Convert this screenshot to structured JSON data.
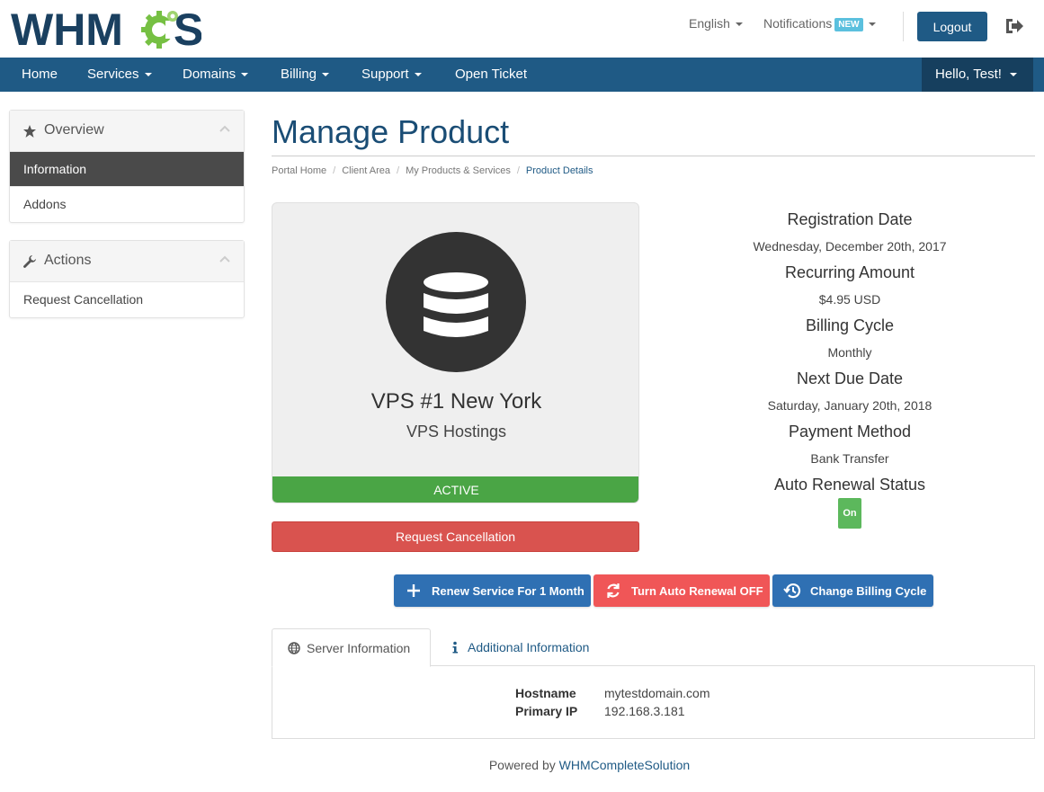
{
  "brand": {
    "logo_text_left": "WHM",
    "logo_text_right": "S",
    "colors": {
      "navy": "#1f5a85",
      "logo_navy": "#1a4060",
      "logo_green": "#76c043"
    }
  },
  "header": {
    "language": "English",
    "notifications": "Notifications",
    "notifications_badge": "NEW",
    "logout": "Logout",
    "exit_icon": "sign-out-icon"
  },
  "nav": {
    "home": "Home",
    "services": "Services",
    "domains": "Domains",
    "billing": "Billing",
    "support": "Support",
    "open_ticket": "Open Ticket",
    "user": "Hello, Test!"
  },
  "sidebar": {
    "overview": {
      "title": "Overview",
      "icon": "star-icon",
      "items": [
        "Information",
        "Addons"
      ],
      "active": "Information"
    },
    "actions": {
      "title": "Actions",
      "icon": "wrench-icon",
      "items": [
        "Request Cancellation"
      ]
    }
  },
  "main": {
    "title": "Manage Product",
    "breadcrumb": [
      "Portal Home",
      "Client Area",
      "My Products & Services",
      "Product Details"
    ]
  },
  "product": {
    "icon": "database-icon",
    "name": "VPS #1 New York",
    "group": "VPS Hostings",
    "status": "ACTIVE",
    "cancel_button": "Request Cancellation"
  },
  "details": {
    "registration_label": "Registration Date",
    "registration_value": "Wednesday, December 20th, 2017",
    "recurring_label": "Recurring Amount",
    "recurring_value": "$4.95 USD",
    "cycle_label": "Billing Cycle",
    "cycle_value": "Monthly",
    "due_label": "Next Due Date",
    "due_value": "Saturday, January 20th, 2018",
    "payment_label": "Payment Method",
    "payment_value": "Bank Transfer",
    "renewal_label": "Auto Renewal Status",
    "renewal_value": "On"
  },
  "actions": {
    "renew": "Renew Service For 1 Month",
    "auto_renewal": "Turn Auto Renewal OFF",
    "change_cycle": "Change Billing Cycle"
  },
  "tabs": {
    "server": "Server Information",
    "additional": "Additional Information",
    "server_info": {
      "hostname_label": "Hostname",
      "hostname_value": "mytestdomain.com",
      "ip_label": "Primary IP",
      "ip_value": "192.168.3.181"
    }
  },
  "footer": {
    "prefix": "Powered by",
    "link": "WHMCompleteSolution"
  }
}
